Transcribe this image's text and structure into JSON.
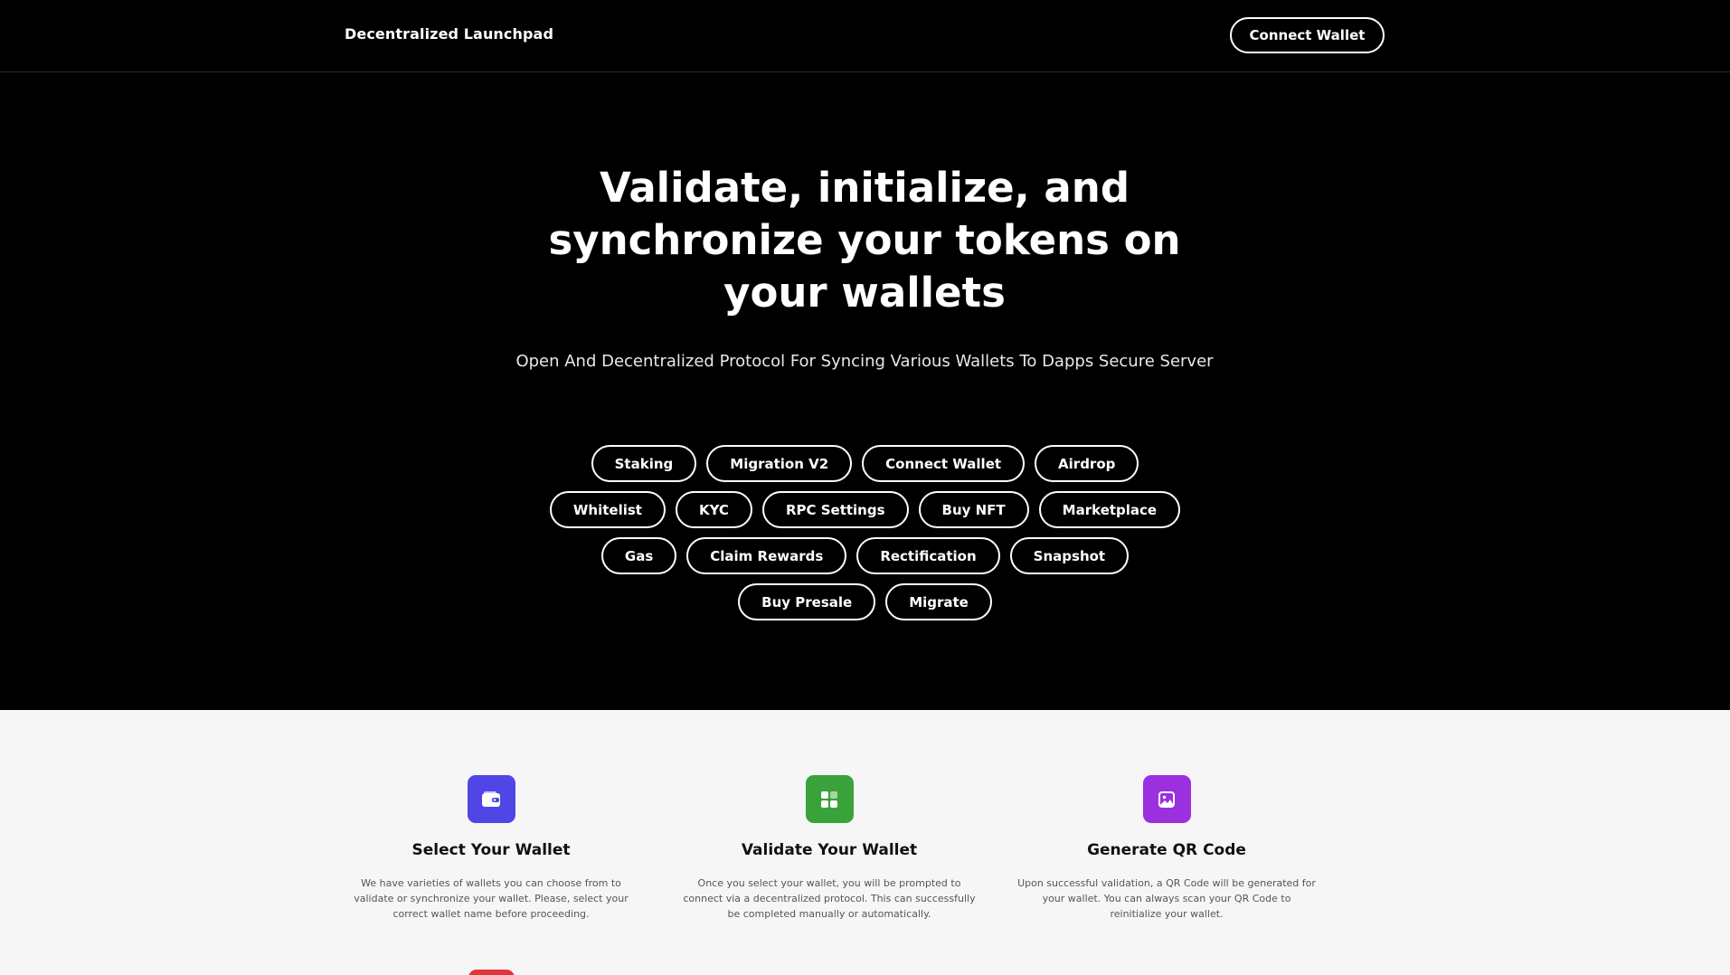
{
  "header": {
    "brand": "Decentralized Launchpad",
    "connect_label": "Connect Wallet"
  },
  "hero": {
    "title": "Validate, initialize, and synchronize your tokens on your wallets",
    "subtitle": "Open And Decentralized Protocol For Syncing Various Wallets To Dapps Secure Server",
    "chip_rows": [
      [
        "Staking",
        "Migration V2",
        "Connect Wallet",
        "Airdrop"
      ],
      [
        "Whitelist",
        "KYC",
        "RPC Settings",
        "Buy NFT",
        "Marketplace"
      ],
      [
        "Gas",
        "Claim Rewards",
        "Rectification",
        "Snapshot"
      ],
      [
        "Buy Presale",
        "Migrate"
      ]
    ]
  },
  "features": [
    {
      "icon": "wallet-icon",
      "color": "#4f46e5",
      "title": "Select Your Wallet",
      "desc": "We have varieties of wallets you can choose from to validate or synchronize your wallet. Please, select your correct wallet name before proceeding."
    },
    {
      "icon": "grid-icon",
      "color": "#3aa23a",
      "title": "Validate Your Wallet",
      "desc": "Once you select your wallet, you will be prompted to connect via a decentralized protocol. This can successfully be completed manually or automatically."
    },
    {
      "icon": "qr-image-icon",
      "color": "#9b30e0",
      "title": "Generate QR Code",
      "desc": "Upon successful validation, a QR Code will be generated for your wallet. You can always scan your QR Code to reinitialize your wallet."
    }
  ],
  "colors": {
    "accent_red": "#e0353b"
  }
}
